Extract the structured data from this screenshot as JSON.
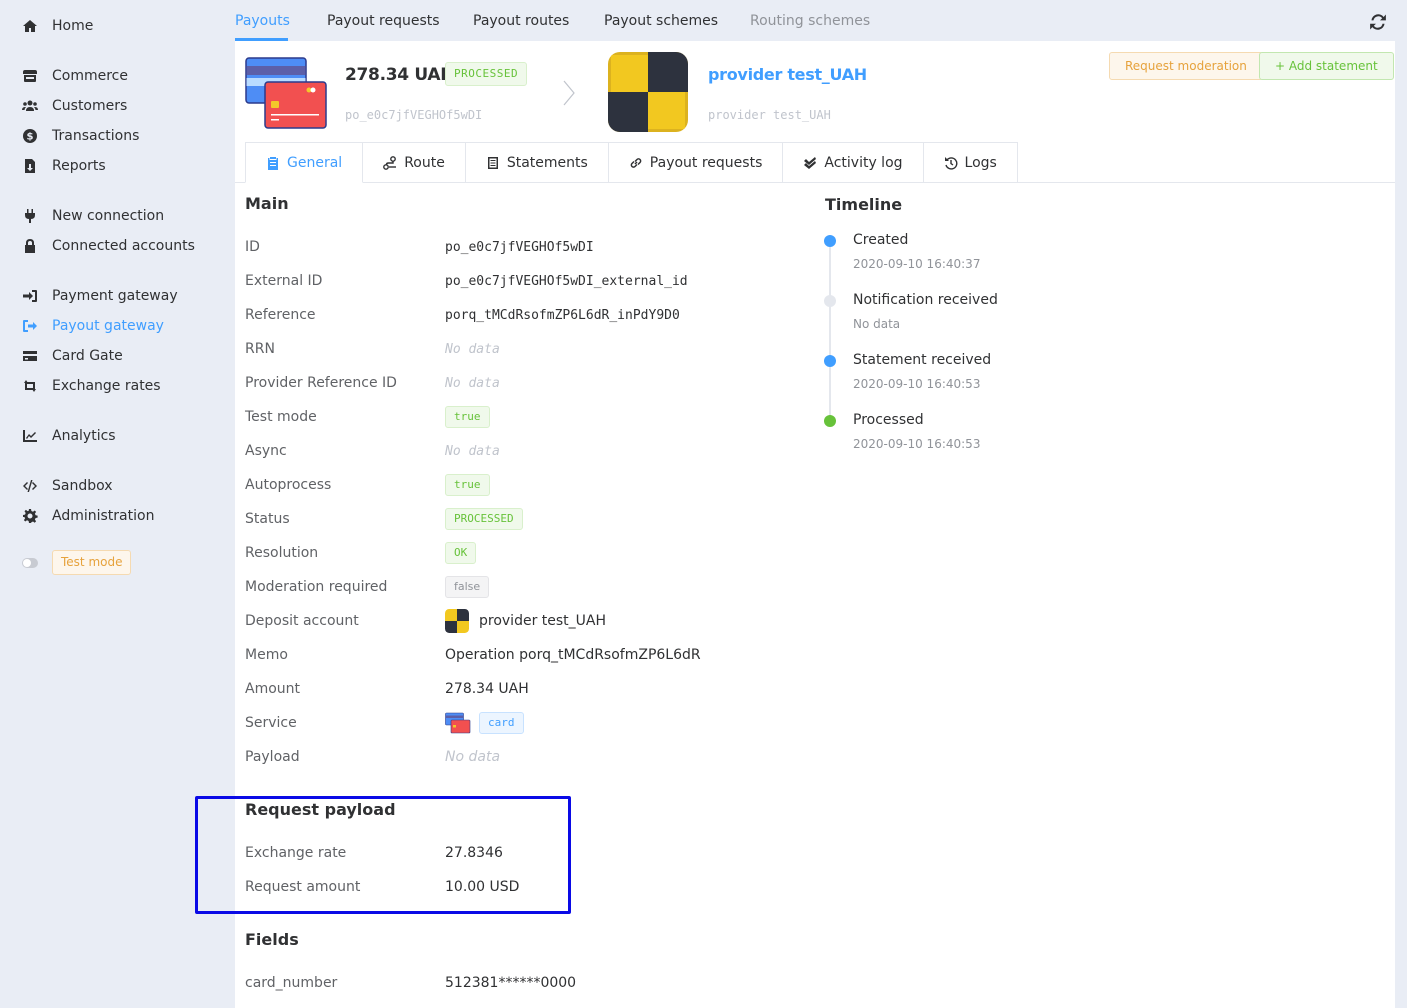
{
  "sidebar": {
    "items": [
      {
        "label": "Home",
        "icon": "home-icon"
      },
      {
        "label": "Commerce",
        "icon": "store-icon"
      },
      {
        "label": "Customers",
        "icon": "users-icon"
      },
      {
        "label": "Transactions",
        "icon": "dollar-circle-icon"
      },
      {
        "label": "Reports",
        "icon": "file-download-icon"
      },
      {
        "label": "New connection",
        "icon": "plug-icon"
      },
      {
        "label": "Connected accounts",
        "icon": "lock-icon"
      },
      {
        "label": "Payment gateway",
        "icon": "sign-in-icon"
      },
      {
        "label": "Payout gateway",
        "icon": "sign-out-icon",
        "active": true
      },
      {
        "label": "Card Gate",
        "icon": "credit-card-icon"
      },
      {
        "label": "Exchange rates",
        "icon": "exchange-icon"
      },
      {
        "label": "Analytics",
        "icon": "chart-line-icon"
      },
      {
        "label": "Sandbox",
        "icon": "code-icon"
      },
      {
        "label": "Administration",
        "icon": "gear-icon"
      }
    ],
    "test_mode_label": "Test mode"
  },
  "top_tabs": [
    {
      "label": "Payouts",
      "active": true
    },
    {
      "label": "Payout requests"
    },
    {
      "label": "Payout routes"
    },
    {
      "label": "Payout schemes"
    },
    {
      "label": "Routing schemes",
      "muted": true
    }
  ],
  "header": {
    "amount": "278.34 UAH",
    "status": "PROCESSED",
    "payout_id": "po_e0c7jfVEGHOf5wDI",
    "provider_name": "provider test_UAH",
    "provider_sub": "provider test_UAH",
    "request_moderation_label": "Request moderation",
    "add_statement_label": "+ Add statement"
  },
  "sub_tabs": [
    {
      "label": "General",
      "icon": "clipboard-icon",
      "active": true
    },
    {
      "label": "Route",
      "icon": "route-icon"
    },
    {
      "label": "Statements",
      "icon": "receipt-icon"
    },
    {
      "label": "Payout requests",
      "icon": "link-icon"
    },
    {
      "label": "Activity log",
      "icon": "double-check-icon"
    },
    {
      "label": "Logs",
      "icon": "history-icon"
    }
  ],
  "main": {
    "title": "Main",
    "rows": {
      "id": {
        "label": "ID",
        "value": "po_e0c7jfVEGHOf5wDI"
      },
      "external_id": {
        "label": "External ID",
        "value": "po_e0c7jfVEGHOf5wDI_external_id"
      },
      "reference": {
        "label": "Reference",
        "value": "porq_tMCdRsofmZP6L6dR_inPdY9D0"
      },
      "rrn": {
        "label": "RRN",
        "value": "No data"
      },
      "provider_ref": {
        "label": "Provider Reference ID",
        "value": "No data"
      },
      "test_mode": {
        "label": "Test mode",
        "value": "true"
      },
      "async": {
        "label": "Async",
        "value": "No data"
      },
      "autoprocess": {
        "label": "Autoprocess",
        "value": "true"
      },
      "status": {
        "label": "Status",
        "value": "PROCESSED"
      },
      "resolution": {
        "label": "Resolution",
        "value": "OK"
      },
      "moderation": {
        "label": "Moderation required",
        "value": "false"
      },
      "deposit_account": {
        "label": "Deposit account",
        "value": "provider test_UAH"
      },
      "memo": {
        "label": "Memo",
        "value": "Operation porq_tMCdRsofmZP6L6dR"
      },
      "amount": {
        "label": "Amount",
        "value": "278.34 UAH"
      },
      "service": {
        "label": "Service",
        "value": "card"
      },
      "payload": {
        "label": "Payload",
        "value": "No data"
      }
    }
  },
  "request_payload": {
    "title": "Request payload",
    "exchange_rate": {
      "label": "Exchange rate",
      "value": "27.8346"
    },
    "request_amount": {
      "label": "Request amount",
      "value": "10.00 USD"
    }
  },
  "fields": {
    "title": "Fields",
    "card_number": {
      "label": "card_number",
      "value": "512381******0000"
    }
  },
  "timeline": {
    "title": "Timeline",
    "events": [
      {
        "label": "Created",
        "time": "2020-09-10 16:40:37",
        "color": "#409eff"
      },
      {
        "label": "Notification received",
        "time": "No data",
        "color": "#e4e7ed"
      },
      {
        "label": "Statement received",
        "time": "2020-09-10 16:40:53",
        "color": "#409eff"
      },
      {
        "label": "Processed",
        "time": "2020-09-10 16:40:53",
        "color": "#67c23a"
      }
    ]
  },
  "colors": {
    "accent": "#409eff",
    "success": "#67c23a",
    "warning": "#e6a23c",
    "highlight_box": "#0a0ae6"
  }
}
